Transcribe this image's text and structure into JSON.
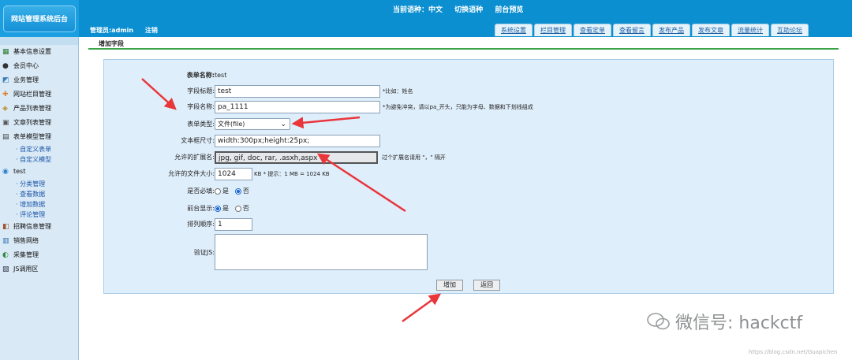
{
  "header": {
    "logo_text": "网站管理系统后台",
    "lang_current": "当前语种：中文",
    "lang_switch": "切换语种",
    "preview": "前台预览",
    "admin_label": "管理员:admin",
    "logout": "注销"
  },
  "tabs": [
    "系统设置",
    "栏目管理",
    "查看定单",
    "查看留言",
    "发布产品",
    "发布文章",
    "流量统计",
    "互助论坛"
  ],
  "sidebar": {
    "items": [
      {
        "label": "基本信息设置",
        "icon": "stats-icon"
      },
      {
        "label": "会员中心",
        "icon": "members-icon"
      },
      {
        "label": "业务管理",
        "icon": "business-icon"
      },
      {
        "label": "网站栏目管理",
        "icon": "tools-icon"
      },
      {
        "label": "产品列表管理",
        "icon": "products-icon"
      },
      {
        "label": "文章列表管理",
        "icon": "articles-icon"
      },
      {
        "label": "表单模型管理",
        "icon": "forms-icon"
      }
    ],
    "form_sub": [
      "· 自定义表单",
      "· 自定义模型"
    ],
    "test_label": "test",
    "test_sub": [
      "· 分类管理",
      "· 查看数据",
      "· 增加数据",
      "· 评论管理"
    ],
    "items2": [
      {
        "label": "招聘信息管理",
        "icon": "recruit-icon"
      },
      {
        "label": "销售网络",
        "icon": "network-icon"
      },
      {
        "label": "采集管理",
        "icon": "collect-icon"
      },
      {
        "label": "JS调用区",
        "icon": "js-icon"
      }
    ]
  },
  "page_title": "增加字段",
  "form": {
    "form_name_label": "表单名称:",
    "form_name_value": "test",
    "field_title_label": "字段标题:",
    "field_title_value": "test",
    "field_title_hint": "*比如：姓名",
    "field_name_label": "字段名称:",
    "field_name_value": "pa_1111",
    "field_name_hint": "*为避免冲突，请以pa_开头，只能为字母、数据和下划线组成",
    "form_type_label": "表单类型:",
    "form_type_value": "文件(file)",
    "textbox_size_label": "文本框尺寸:",
    "textbox_size_value": "width:300px;height:25px;",
    "ext_label": "允许的扩展名:",
    "ext_value": "jpg, gif, doc, rar, .asxh,aspx",
    "ext_hint": "过个扩展名请用 \"，\" 隔开",
    "filesize_label": "允许的文件大小:",
    "filesize_value": "1024",
    "filesize_hint": "KB * 提示：1 MB = 1024 KB",
    "required_label": "是否必填:",
    "required_yes": "是",
    "required_no": "否",
    "frontend_label": "前台显示:",
    "frontend_yes": "是",
    "frontend_no": "否",
    "order_label": "排列顺序:",
    "order_value": "1",
    "validate_label": "验证JS:",
    "validate_value": "",
    "add_button": "增加",
    "back_button": "返回"
  },
  "watermark": {
    "text": "微信号: hackctf",
    "url": "https://blog.csdn.net/Guapichen"
  },
  "colors": {
    "header_blue": "#0b8fd0",
    "panel_bg": "#dfeefb",
    "arrow_red": "#e8363a",
    "title_underline": "#3ba34a"
  }
}
